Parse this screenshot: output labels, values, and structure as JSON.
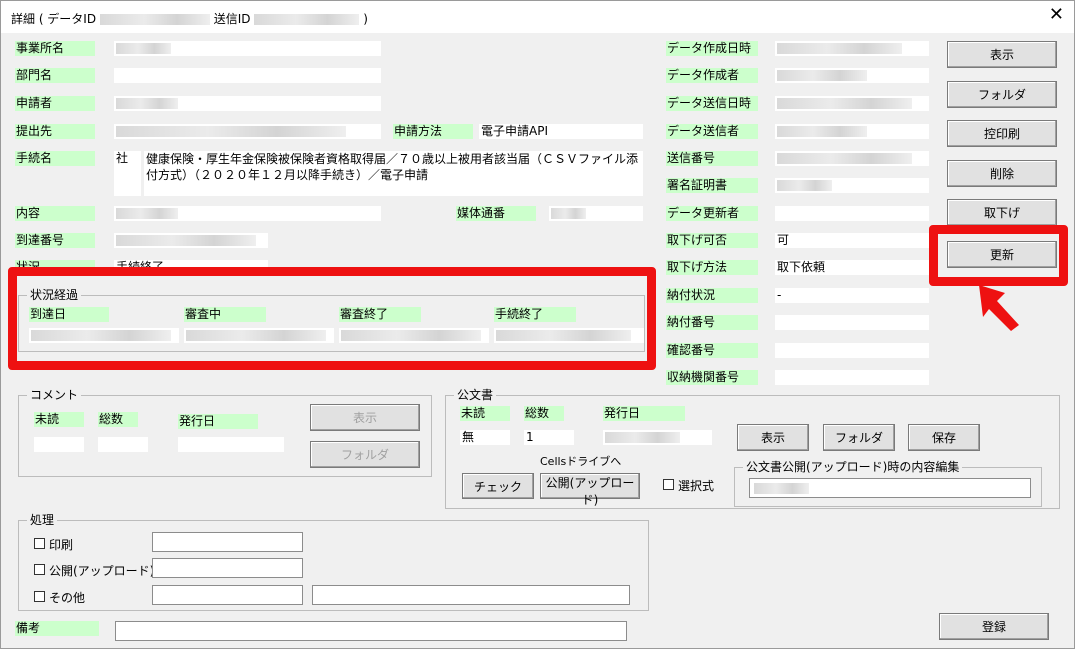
{
  "window": {
    "title": "詳細 ( データID",
    "title_mid": "送信ID",
    "title_end": " )",
    "close_glyph": "✕"
  },
  "left": {
    "jigyosho": "事業所名",
    "bumon": "部門名",
    "shinseisha": "申請者",
    "teishutsusaki": "提出先",
    "shinsei_hoho_label": "申請方法",
    "shinsei_hoho_value": "電子申請API",
    "tetsuzuki_label": "手続名",
    "tetsuzuki_prefix": "社",
    "tetsuzuki_value": "健康保険・厚生年金保険被保険者資格取得届／７０歳以上被用者該当届（ＣＳＶファイル添付方式）（２０２０年１２月以降手続き）／電子申請",
    "naiyo": "内容",
    "baitai_label": "媒体通番",
    "totatsu": "到達番号",
    "jokyo_label": "状況",
    "jokyo_value": "手続終了"
  },
  "progress": {
    "title": "状況経過",
    "cols": [
      "到達日",
      "審査中",
      "審査終了",
      "手続終了"
    ]
  },
  "middle": {
    "rows": [
      {
        "label": "データ作成日時",
        "value": ""
      },
      {
        "label": "データ作成者",
        "value": ""
      },
      {
        "label": "データ送信日時",
        "value": ""
      },
      {
        "label": "データ送信者",
        "value": ""
      },
      {
        "label": "送信番号",
        "value": ""
      },
      {
        "label": "署名証明書",
        "value": ""
      },
      {
        "label": "データ更新者",
        "value": ""
      },
      {
        "label": "取下げ可否",
        "value": "可"
      },
      {
        "label": "取下げ方法",
        "value": "取下依頼"
      },
      {
        "label": "納付状況",
        "value": "-"
      },
      {
        "label": "納付番号",
        "value": ""
      },
      {
        "label": "確認番号",
        "value": ""
      },
      {
        "label": "収納機関番号",
        "value": ""
      }
    ]
  },
  "buttons": {
    "hyoji": "表示",
    "folder": "フォルダ",
    "hikae": "控印刷",
    "sakujo": "削除",
    "torisage": "取下げ",
    "koshin": "更新"
  },
  "comment": {
    "title": "コメント",
    "midoku": "未読",
    "sosu": "総数",
    "hakkobi": "発行日",
    "hyoji": "表示",
    "folder": "フォルダ"
  },
  "kobunsho": {
    "title": "公文書",
    "midoku": "未読",
    "sosu": "総数",
    "hakkobi": "発行日",
    "midoku_value": "無",
    "sosu_value": "1",
    "hyoji": "表示",
    "folder": "フォルダ",
    "hozon": "保存",
    "cells_label": "Cellsドライブへ",
    "check": "チェック",
    "kokai": "公開(アップロード)",
    "sentaku": "選択式",
    "edit_title": "公文書公開(アップロード)時の内容編集"
  },
  "shori": {
    "title": "処理",
    "insatsu": "印刷",
    "kokai": "公開(アップロード)",
    "sonota": "その他"
  },
  "biko": "備考",
  "toroku": "登録",
  "colors": {
    "label_bg": "#ccffcc",
    "highlight": "#ee1111",
    "window_bg": "#f0f0f0"
  }
}
